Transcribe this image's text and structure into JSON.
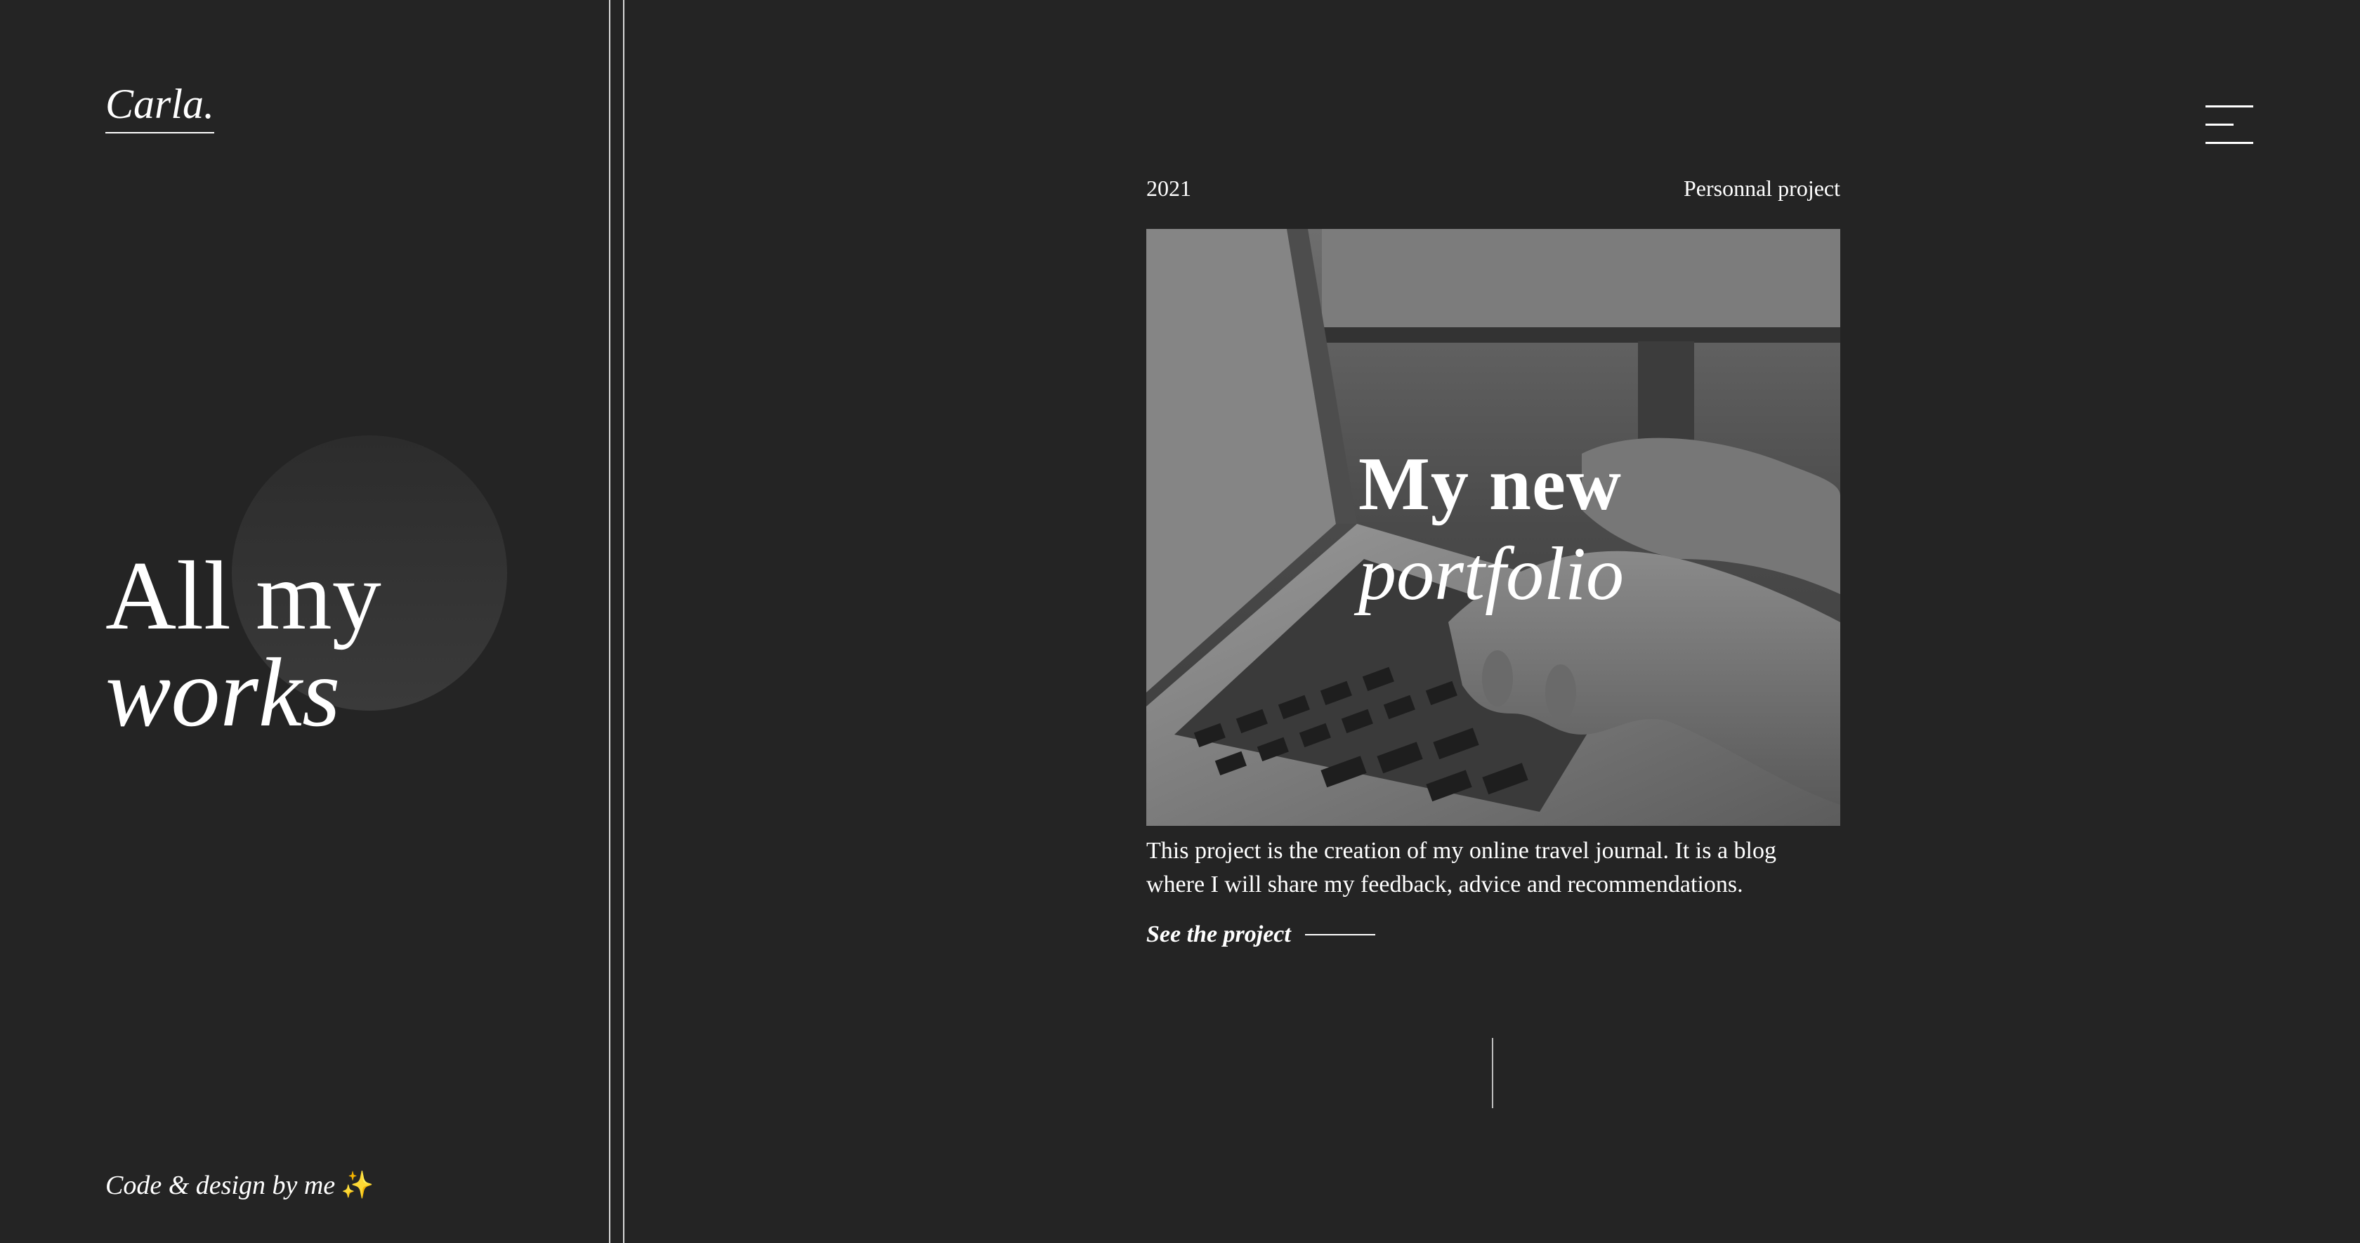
{
  "sidebar": {
    "logo": "Carla.",
    "title_line1": "All my",
    "title_line2": "works",
    "credit": "Code & design by me",
    "credit_emoji": "✨"
  },
  "menu": {
    "icon": "hamburger-menu-icon"
  },
  "project": {
    "year": "2021",
    "type": "Personnal project",
    "image_title_line1": "My new",
    "image_title_line2": "portfolio",
    "image_subject": "grayscale photo of hands typing on a laptop keyboard",
    "description": "This project is the creation of my online travel journal. It is a blog where I will share my feedback, advice and recommendations.",
    "link_label": "See the project"
  },
  "colors": {
    "background": "#242424",
    "text": "#ffffff",
    "divider": "#d8d8d8",
    "sparkle": "#f3c747"
  }
}
